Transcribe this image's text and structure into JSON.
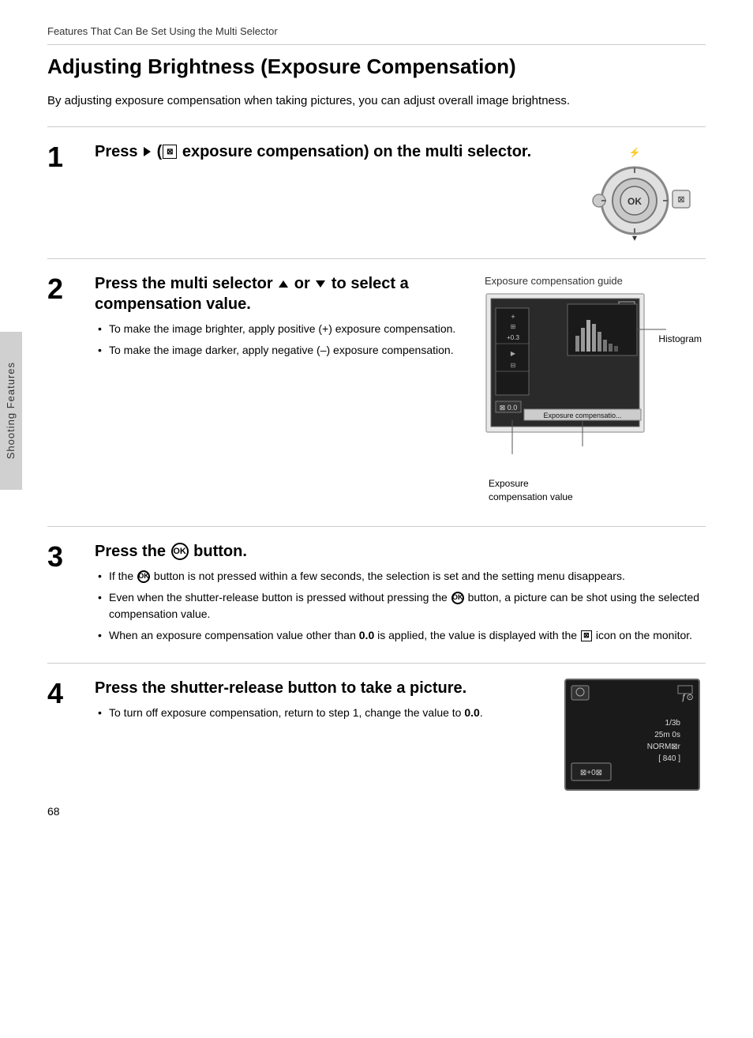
{
  "page": {
    "section_header": "Features That Can Be Set Using the Multi Selector",
    "main_title": "Adjusting Brightness (Exposure Compensation)",
    "intro_text": "By adjusting exposure compensation when taking pictures, you can adjust overall image brightness.",
    "page_number": "68",
    "sidebar_label": "Shooting Features"
  },
  "steps": [
    {
      "number": "1",
      "title_parts": [
        "Press",
        "▶",
        "(",
        "⊠",
        " exposure compensation) on the multi selector."
      ],
      "title_text": "Press ▶ (⊠ exposure compensation) on the multi selector.",
      "bullets": [],
      "has_image": true
    },
    {
      "number": "2",
      "title_text": "Press the multi selector ▲ or ▼ to select a compensation value.",
      "bullets": [
        "To make the image brighter, apply positive (+) exposure compensation.",
        "To make the image darker, apply negative (–) exposure compensation."
      ],
      "has_diagram": true,
      "diagram_label": "Exposure compensation guide",
      "histogram_label": "Histogram",
      "comp_value_label": "Exposure\ncompensation value"
    },
    {
      "number": "3",
      "title_text": "Press the ⊙K button.",
      "bullets": [
        "If the ⊙K button is not pressed within a few seconds, the selection is set and the setting menu disappears.",
        "Even when the shutter-release button is pressed without pressing the ⊙K button, a picture can be shot using the selected compensation value.",
        "When an exposure compensation value other than 0.0 is applied, the value is displayed with the ⊠ icon on the monitor."
      ]
    },
    {
      "number": "4",
      "title_text": "Press the shutter-release button to take a picture.",
      "bullets": [
        "To turn off exposure compensation, return to step 1, change the value to 0.0."
      ],
      "has_camera_screen": true
    }
  ],
  "camera_screen": {
    "top_left": "🔲",
    "top_right": "☐",
    "sub_top_right": "ƒ⊙",
    "values": [
      "1/3b",
      "25m 0s",
      "NORM⊠r",
      "[ 840 ]"
    ],
    "bottom_left_box": "⊠+0⊠"
  }
}
